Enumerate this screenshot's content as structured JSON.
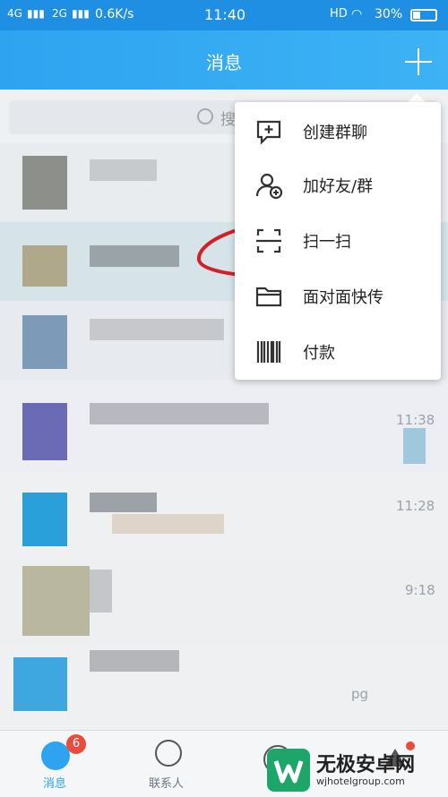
{
  "status_bar": {
    "net1": "4G",
    "net2": "2G",
    "speed": "0.6K/s",
    "time": "11:40",
    "hd": "HD",
    "battery": "30%"
  },
  "header": {
    "title": "消息",
    "add_icon": "plus-icon"
  },
  "search": {
    "placeholder": "搜"
  },
  "menu": {
    "items": [
      {
        "label": "创建群聊",
        "icon": "create-group-icon"
      },
      {
        "label": "加好友/群",
        "icon": "add-friend-icon"
      },
      {
        "label": "扫一扫",
        "icon": "scan-icon"
      },
      {
        "label": "面对面快传",
        "icon": "folder-icon"
      },
      {
        "label": "付款",
        "icon": "barcode-icon"
      }
    ]
  },
  "conversations": {
    "times": [
      "11:38",
      "11:28",
      "9:18"
    ],
    "partial": "pg"
  },
  "nav": {
    "messages_label": "消息",
    "messages_badge": "6",
    "contacts_label": "联系人"
  },
  "watermark": {
    "title": "无极安卓网",
    "url": "wjhotelgroup.com"
  },
  "colors": {
    "primary": "#2ea3f0",
    "badge": "#e74c3c",
    "annotation": "#d0202a"
  }
}
